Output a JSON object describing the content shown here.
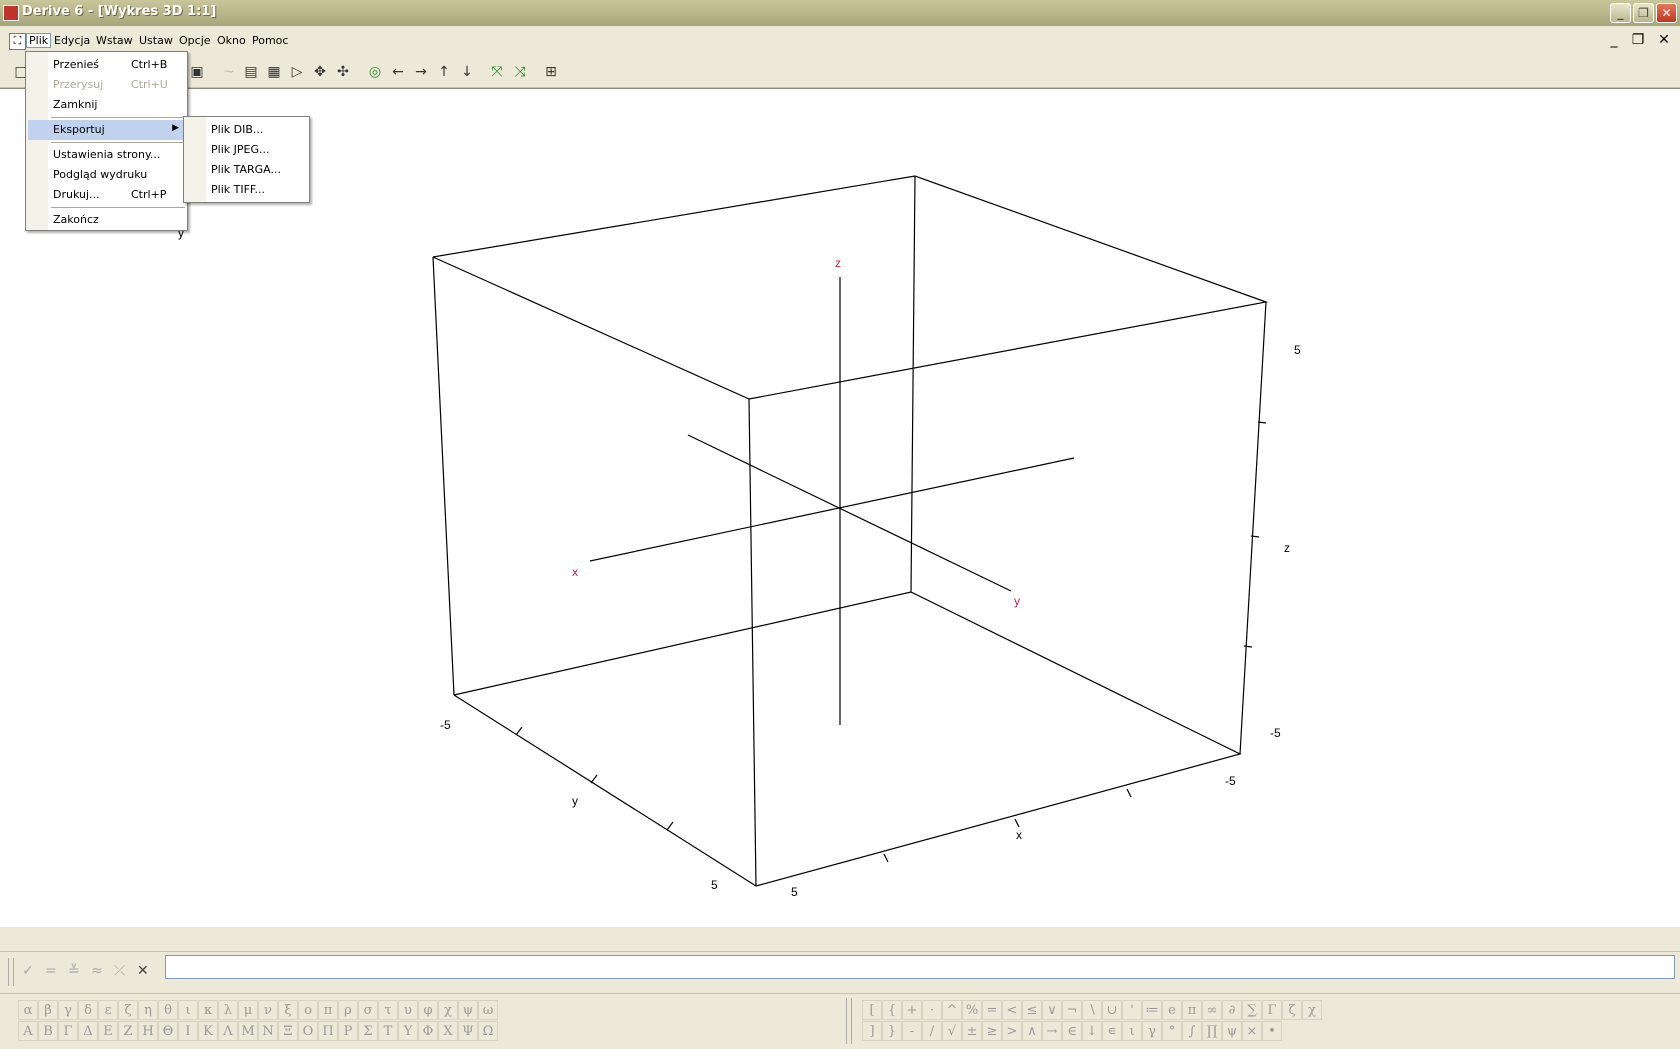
{
  "window": {
    "title": "Derive 6 - [Wykres 3D 1:1]"
  },
  "menubar": {
    "items": [
      "Plik",
      "Edycja",
      "Wstaw",
      "Ustaw",
      "Opcje",
      "Okno",
      "Pomoc"
    ]
  },
  "file_menu": {
    "items": [
      {
        "label": "Przenieś",
        "shortcut": "Ctrl+B",
        "enabled": true
      },
      {
        "label": "Przerysuj",
        "shortcut": "Ctrl+U",
        "enabled": false
      },
      {
        "label": "Zamknij",
        "shortcut": "",
        "enabled": true
      },
      {
        "label": "Eksportuj",
        "shortcut": "",
        "enabled": true,
        "submenu": true
      },
      {
        "label": "Ustawienia strony...",
        "shortcut": "",
        "enabled": true
      },
      {
        "label": "Podgląd wydruku",
        "shortcut": "",
        "enabled": true
      },
      {
        "label": "Drukuj...",
        "shortcut": "Ctrl+P",
        "enabled": true
      },
      {
        "label": "Zakończ",
        "shortcut": "",
        "enabled": true
      }
    ]
  },
  "export_submenu": {
    "items": [
      "Plik DIB...",
      "Plik JPEG...",
      "Plik TARGA...",
      "Plik TIFF..."
    ]
  },
  "plot": {
    "axis_labels": {
      "x": "x",
      "y": "y",
      "z": "z"
    },
    "axis_label_color": "#cc2244",
    "tick_labels": {
      "left_top": "-5",
      "y_bottom": "5",
      "x_left": "5",
      "x_right": "-5",
      "z_top": "5",
      "z_bottom": "-5",
      "y_side_label": "y",
      "x_side_label": "x",
      "z_side_label": "z",
      "y_stray": "y"
    }
  },
  "symbols": {
    "greek_lower": [
      "α",
      "β",
      "γ",
      "δ",
      "ε",
      "ζ",
      "η",
      "θ",
      "ι",
      "κ",
      "λ",
      "μ",
      "ν",
      "ξ",
      "ο",
      "π",
      "ρ",
      "σ",
      "τ",
      "υ",
      "φ",
      "χ",
      "ψ",
      "ω"
    ],
    "greek_upper": [
      "Α",
      "Β",
      "Γ",
      "Δ",
      "Ε",
      "Ζ",
      "Η",
      "Θ",
      "Ι",
      "Κ",
      "Λ",
      "Μ",
      "Ν",
      "Ξ",
      "Ο",
      "Π",
      "Ρ",
      "Σ",
      "Τ",
      "Υ",
      "Φ",
      "Χ",
      "Ψ",
      "Ω"
    ],
    "ops_row1": [
      "[",
      "{",
      "+",
      "·",
      "^",
      "%",
      "=",
      "<",
      "≤",
      "∨",
      "¬",
      "∖",
      "∪",
      "'",
      "≔",
      "e",
      "π",
      "∞",
      "∂",
      "∑",
      "Γ",
      "ζ",
      "χ"
    ],
    "ops_row2": [
      "]",
      "}",
      "-",
      "/",
      "√",
      "±",
      "≥",
      ">",
      "∧",
      "→",
      "∈",
      "↓",
      "∊",
      "ι",
      "γ",
      "°",
      "∫",
      "∏",
      "ψ",
      "×",
      "•"
    ]
  }
}
